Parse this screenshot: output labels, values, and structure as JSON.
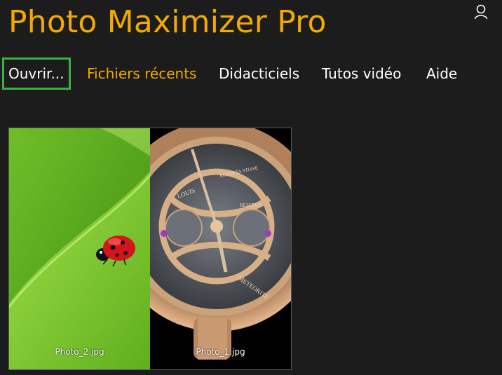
{
  "app": {
    "title": "Photo Maximizer Pro",
    "accent_color": "#f2a900",
    "focus_color": "#3cb043",
    "user_icon": "user-icon"
  },
  "nav": {
    "items": [
      {
        "label": "Ouvrir...",
        "state": "focused"
      },
      {
        "label": "Fichiers récents",
        "state": "active"
      },
      {
        "label": "Didacticiels",
        "state": "normal"
      },
      {
        "label": "Tutos vidéo",
        "state": "normal"
      },
      {
        "label": "Aide",
        "state": "normal"
      }
    ]
  },
  "gallery": {
    "photos": [
      {
        "filename": "Photo_2.jpg",
        "subject": "ladybug on leaf"
      },
      {
        "filename": "Photo_1.jpg",
        "subject": "watch movement",
        "dial_text": [
          "LOUIS",
          "ROSEGTA STONE",
          "METEORITE",
          "RESERVE"
        ]
      }
    ]
  }
}
